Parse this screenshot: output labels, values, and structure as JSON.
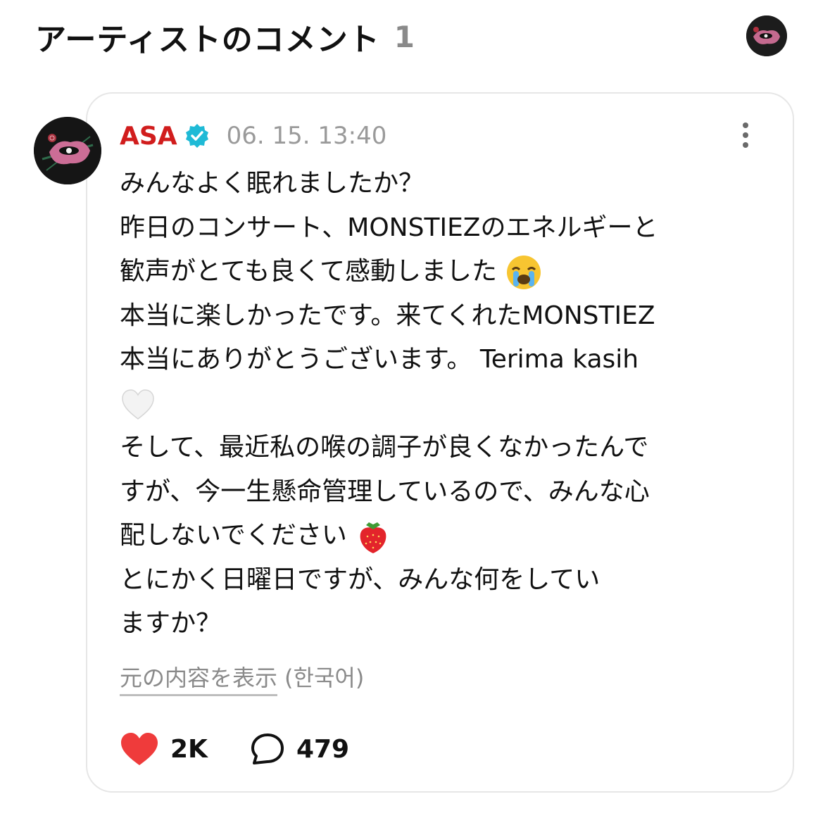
{
  "header": {
    "title": "アーティストのコメント",
    "count": "1"
  },
  "post": {
    "author": "ASA",
    "timestamp": "06. 15. 13:40",
    "lines": [
      "みんなよく眠れましたか？",
      "昨日のコンサート、MONSTIEZのエネルギーと",
      "歓声がとても良くて感動しました",
      "本当に楽しかったです。来てくれたMONSTIEZ",
      "本当にありがとうございます。 Terima kasih",
      "",
      "そして、最近私の喉の調子が良くなかったんで",
      "すが、今一生懸命管理しているので、みんな心",
      "配しないでください",
      "とにかく日曜日ですが、みんな何をしてい",
      "ますか？"
    ],
    "emojis": {
      "crying": "loudly-crying-face",
      "heart": "white-heart",
      "fruit": "strawberry"
    },
    "translate_link": "元の内容を表示",
    "translate_lang": "(한국어)",
    "likes": "2K",
    "comments": "479"
  },
  "colors": {
    "author": "#d11d1d",
    "verified": "#1fbad6",
    "like": "#ef3b3b",
    "muted": "#8a8a8a"
  }
}
